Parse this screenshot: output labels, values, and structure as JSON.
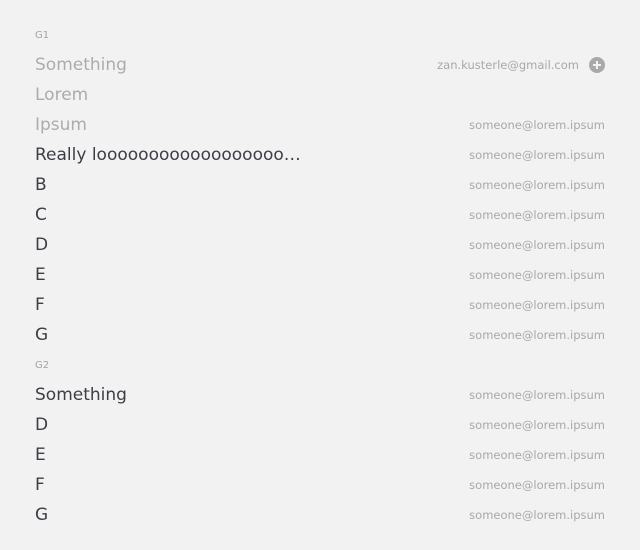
{
  "groups": [
    {
      "title": "G1",
      "rows": [
        {
          "label": "Something",
          "email": "zan.kusterle@gmail.com",
          "muted": true,
          "icon": "add-circle-icon"
        },
        {
          "label": "Lorem",
          "email": "",
          "muted": true
        },
        {
          "label": "Ipsum",
          "email": "someone@lorem.ipsum",
          "muted": true
        },
        {
          "label": "Really looooooooooooooooooo...",
          "email": "someone@lorem.ipsum",
          "muted": false
        },
        {
          "label": "B",
          "email": "someone@lorem.ipsum",
          "muted": false
        },
        {
          "label": "C",
          "email": "someone@lorem.ipsum",
          "muted": false
        },
        {
          "label": "D",
          "email": "someone@lorem.ipsum",
          "muted": false
        },
        {
          "label": "E",
          "email": "someone@lorem.ipsum",
          "muted": false
        },
        {
          "label": "F",
          "email": "someone@lorem.ipsum",
          "muted": false
        },
        {
          "label": "G",
          "email": "someone@lorem.ipsum",
          "muted": false
        }
      ]
    },
    {
      "title": "G2",
      "rows": [
        {
          "label": "Something",
          "email": "someone@lorem.ipsum",
          "muted": false
        },
        {
          "label": "D",
          "email": "someone@lorem.ipsum",
          "muted": false
        },
        {
          "label": "E",
          "email": "someone@lorem.ipsum",
          "muted": false
        },
        {
          "label": "F",
          "email": "someone@lorem.ipsum",
          "muted": false
        },
        {
          "label": "G",
          "email": "someone@lorem.ipsum",
          "muted": false
        }
      ]
    }
  ],
  "colors": {
    "background": "#f2f2f2",
    "text": "#3d3d45",
    "muted_text": "#acacac",
    "email_text": "#a8a8a8",
    "header_text": "#a4a4a4",
    "icon": "#a9a9a9"
  }
}
